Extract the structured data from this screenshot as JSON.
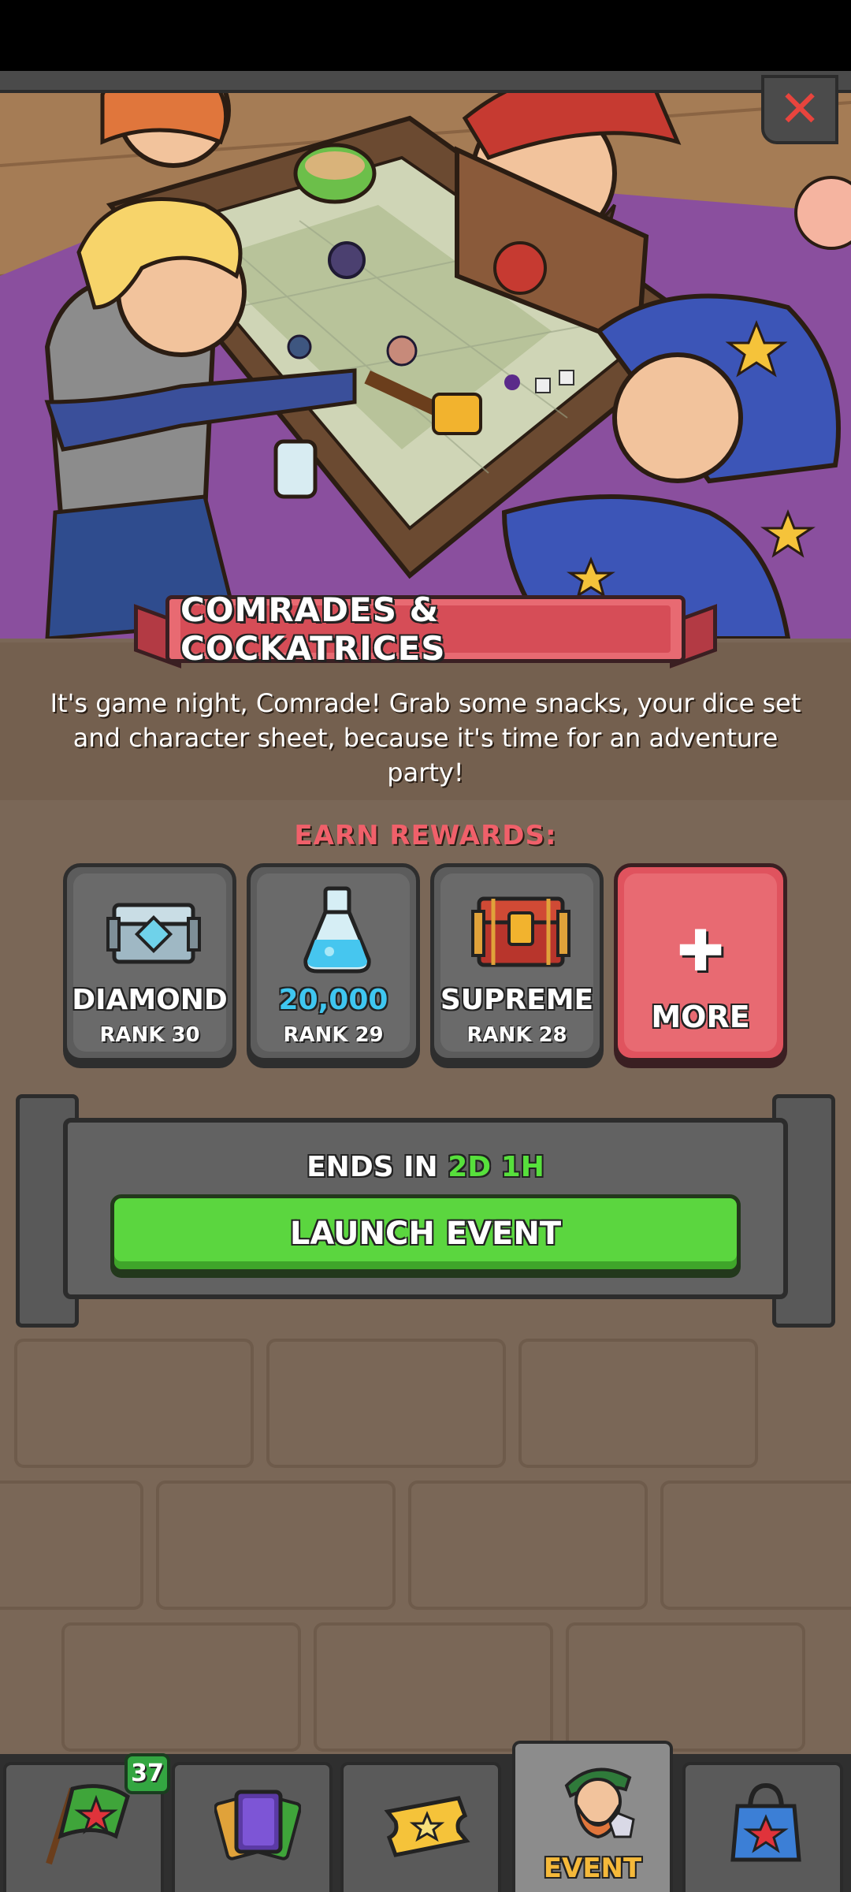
{
  "event": {
    "title": "COMRADES & COCKATRICES",
    "description": "It's game night, Comrade! Grab some snacks, your dice set and character sheet, because it's time for an adventure party!",
    "earn_rewards_label": "EARN REWARDS:",
    "ends_in_label": "ENDS IN",
    "ends_in_time": "2D 1H",
    "launch_label": "LAUNCH EVENT",
    "close_icon": "close-icon"
  },
  "rewards": [
    {
      "name": "DIAMOND",
      "rank": "RANK 30",
      "icon": "diamond-chest-icon"
    },
    {
      "name": "20,000",
      "rank": "RANK 29",
      "icon": "potion-flask-icon",
      "color": "#3fc6f0"
    },
    {
      "name": "SUPREME",
      "rank": "RANK 28",
      "icon": "supreme-chest-icon"
    },
    {
      "name": "MORE",
      "icon": "plus-icon",
      "color": "#e0535e"
    }
  ],
  "nav": {
    "badge_count": "37",
    "active_label": "EVENT",
    "tabs": [
      "flag-icon",
      "cards-icon",
      "ticket-icon",
      "event-wizard-icon",
      "shop-bag-icon"
    ]
  },
  "colors": {
    "accent_green": "#5bd63f",
    "accent_red": "#e86a72",
    "background": "#7a6757"
  }
}
